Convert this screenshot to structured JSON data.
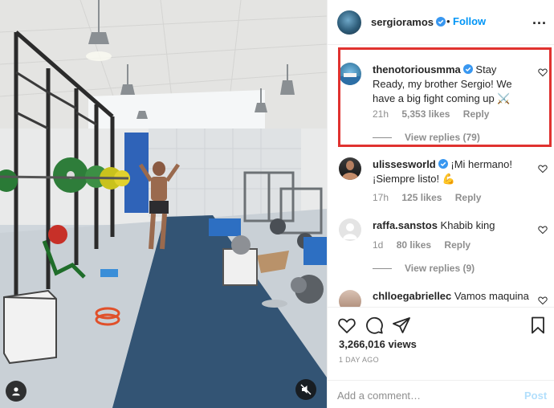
{
  "header": {
    "username": "sergioramos",
    "separator": "•",
    "follow_label": "Follow",
    "more_label": "..."
  },
  "comments": [
    {
      "username": "thenotoriousmma",
      "verified": true,
      "text": "Stay Ready, my brother Sergio! We have a big fight coming up ⚔️",
      "time": "21h",
      "likes": "5,353 likes",
      "reply_label": "Reply",
      "view_replies": "View replies (79)",
      "highlighted": true
    },
    {
      "username": "ulissesworld",
      "verified": true,
      "text": "¡Mi hermano! ¡Siempre listo! 💪",
      "time": "17h",
      "likes": "125 likes",
      "reply_label": "Reply"
    },
    {
      "username": "raffa.sanstos",
      "verified": false,
      "text": "Khabib king",
      "time": "1d",
      "likes": "80 likes",
      "reply_label": "Reply",
      "view_replies": "View replies (9)"
    },
    {
      "username": "chlloegabriellec",
      "verified": false,
      "text": "Vamos maquina"
    }
  ],
  "post": {
    "views": "3,266,016 views",
    "date": "1 DAY AGO"
  },
  "comment_box": {
    "placeholder": "Add a comment…",
    "post_label": "Post"
  },
  "icons": {
    "like": "heart-icon",
    "comment": "comment-icon",
    "share": "share-icon",
    "save": "bookmark-icon",
    "mute": "speaker-muted-icon",
    "user_tag": "user-tag-icon"
  },
  "colors": {
    "follow_blue": "#0095f6",
    "post_disabled_blue": "#b2dffc",
    "highlight_red": "#e0322f",
    "secondary_text": "#8e8e8e"
  }
}
